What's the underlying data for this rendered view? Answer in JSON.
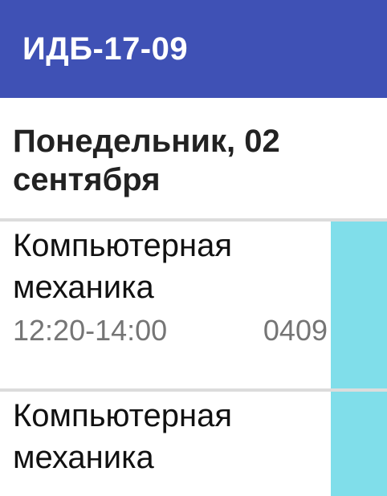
{
  "app_bar": {
    "title": "ИДБ-17-09"
  },
  "day": {
    "title": "Понедельник, 02 сентября"
  },
  "lessons": [
    {
      "name": "Компьютерная механика",
      "time": "12:20-14:00",
      "room": "0409"
    },
    {
      "name": "Компьютерная механика"
    }
  ],
  "colors": {
    "app_bar": "#3f51b5",
    "accent": "#80deea",
    "divider": "#dcdcdc"
  }
}
